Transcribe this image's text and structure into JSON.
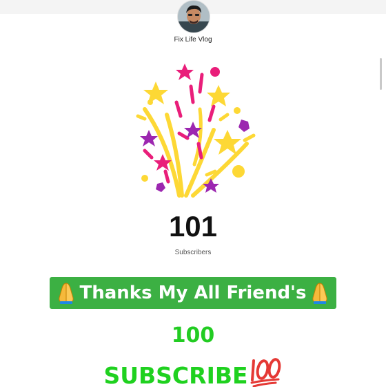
{
  "channel": {
    "name": "Fix Life Vlog"
  },
  "subscribers": {
    "count": "101",
    "label": "Subscribers"
  },
  "banner": {
    "text": "Thanks My All Friend's"
  },
  "overlay": {
    "milestone": "100",
    "subscribe": "SUBSCRIBE"
  },
  "colors": {
    "banner_bg": "#3cb043",
    "green_text": "#1fd11f",
    "confetti_yellow": "#fdd835",
    "confetti_pink": "#e91e7a",
    "confetti_purple": "#9c27b0"
  },
  "icons": [
    "avatar-photo",
    "confetti-illustration",
    "folded-hands-icon",
    "hundred-points-icon"
  ]
}
